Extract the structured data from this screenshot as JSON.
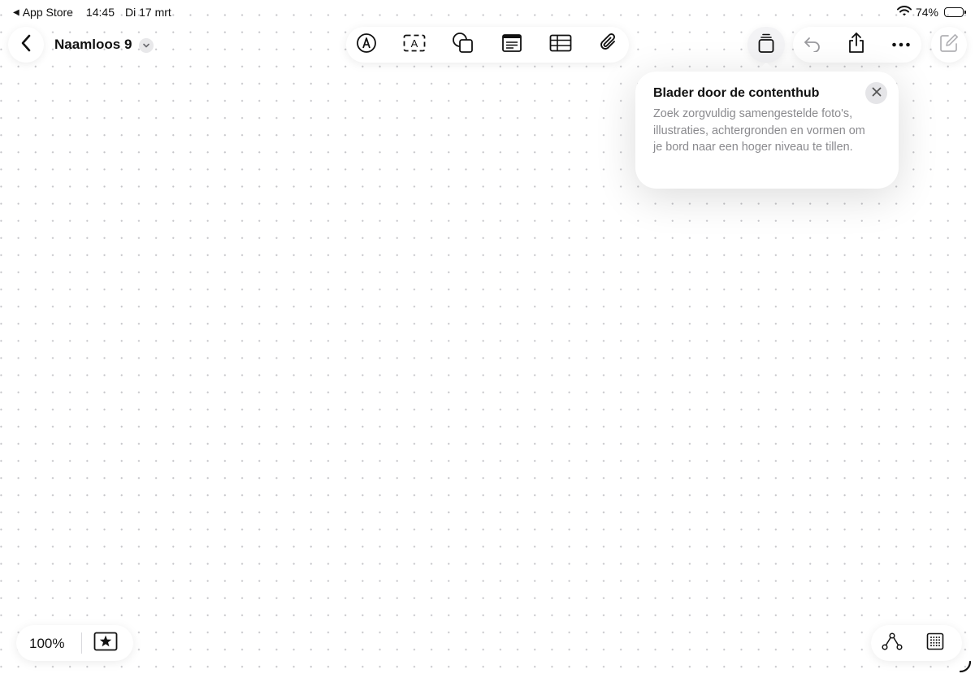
{
  "status_bar": {
    "back_app": "App Store",
    "time": "14:45",
    "date": "Di 17 mrt",
    "battery_percent": "74%",
    "battery_level": 0.74,
    "icons": [
      "back-triangle-icon",
      "wifi-icon",
      "battery-icon"
    ]
  },
  "header": {
    "document_title": "Naamloos 9",
    "icons": [
      "back-chevron-icon",
      "title-chevron-down-icon"
    ]
  },
  "toolbar": {
    "tools": [
      "pen-icon",
      "text-box-icon",
      "shapes-icon",
      "sticky-note-icon",
      "table-icon",
      "attachment-icon"
    ],
    "right_tools": [
      "content-hub-icon",
      "undo-icon",
      "share-icon",
      "more-icon",
      "compose-icon"
    ]
  },
  "popover": {
    "title": "Blader door de contenthub",
    "body": "Zoek zorgvuldig samengestelde foto's, illustraties, achtergronden en vormen om je bord naar een hoger niveau te tillen."
  },
  "bottom": {
    "zoom": "100%",
    "icons": [
      "favorites-star-icon",
      "connector-icon",
      "grid-icon"
    ]
  },
  "colors": {
    "canvas": "#ffffff",
    "dot": "#c4c4c8",
    "icon": "#111111",
    "muted_text": "#8a8a8e",
    "disabled_icon": "#9a9a9e"
  }
}
